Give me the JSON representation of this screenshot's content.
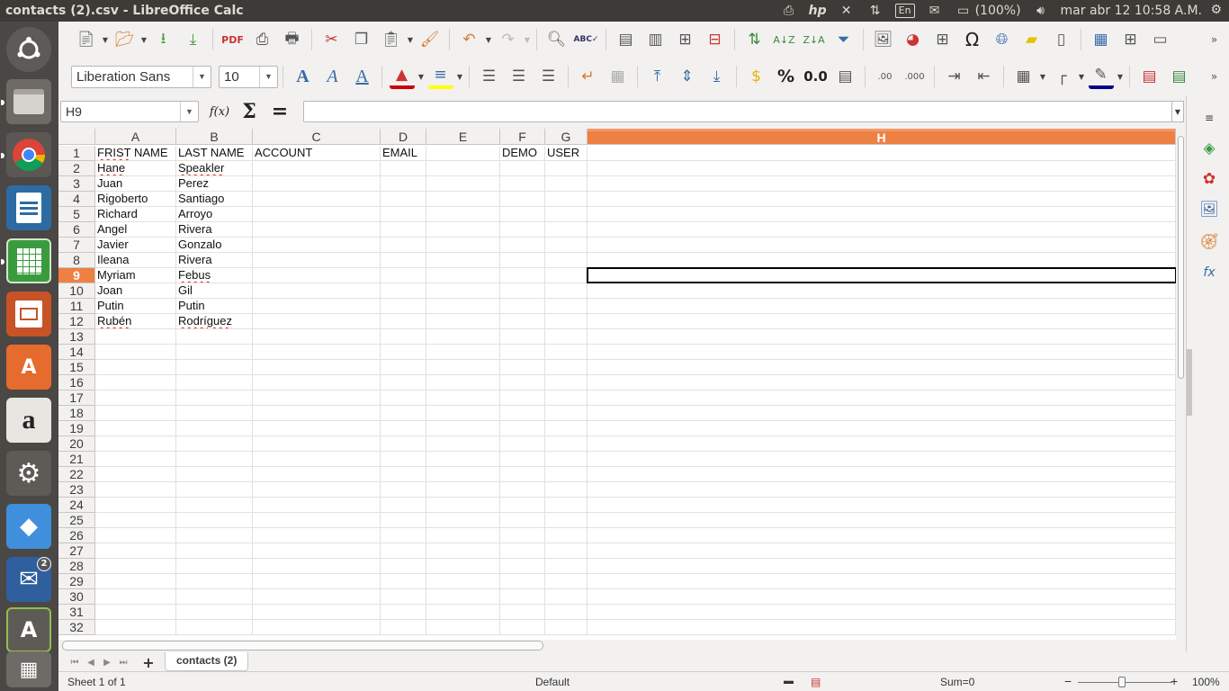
{
  "window": {
    "title": "contacts (2).csv - LibreOffice Calc"
  },
  "tray": {
    "keyboard_layout": "En",
    "battery": "(100%)",
    "clock": "mar abr 12 10:58 A.M."
  },
  "launcher": {
    "notification_badge": "2"
  },
  "toolbar": {
    "font_name": "Liberation Sans",
    "font_size": "10",
    "percent_label": "%",
    "number_label": "0.0",
    "omega_label": "Ω"
  },
  "formula_bar": {
    "cell_ref": "H9",
    "fx_label": "f(x)",
    "sum_label": "Σ",
    "equals_label": "=",
    "content": ""
  },
  "grid": {
    "columns": [
      "A",
      "B",
      "C",
      "D",
      "E",
      "F",
      "G",
      "H"
    ],
    "selected_column": "H",
    "selected_row": 9,
    "row_numbers": [
      1,
      2,
      3,
      4,
      5,
      6,
      7,
      8,
      9,
      10,
      11,
      12,
      13,
      14,
      15,
      16,
      17,
      18,
      19,
      20,
      21,
      22,
      23,
      24,
      25,
      26,
      27,
      28,
      29,
      30,
      31,
      32
    ],
    "header_row": [
      "FRIST NAME",
      "LAST NAME",
      "ACCOUNT",
      "EMAIL",
      "",
      "DEMO",
      "USER"
    ],
    "rows": [
      [
        "Hane",
        "Speakler"
      ],
      [
        "Juan",
        "Perez"
      ],
      [
        "Rigoberto",
        "Santiago"
      ],
      [
        "Richard",
        "Arroyo"
      ],
      [
        "Angel",
        "Rivera"
      ],
      [
        "Javier",
        "Gonzalo"
      ],
      [
        "Ileana",
        "Rivera"
      ],
      [
        "Myriam",
        "Febus"
      ],
      [
        "Joan",
        "Gil"
      ],
      [
        "Putin",
        "Putin"
      ],
      [
        "Rubén",
        "Rodríguez"
      ]
    ],
    "spellcheck_flagged": [
      "FRIST",
      "Hane",
      "Speakler",
      "Febus",
      "Rubén",
      "Rodríguez"
    ]
  },
  "sheet_tabs": {
    "add_label": "+",
    "tabs": [
      "contacts (2)"
    ]
  },
  "status_bar": {
    "sheet_info": "Sheet 1 of 1",
    "page_style": "Default",
    "sum": "Sum=0",
    "zoom_minus": "−",
    "zoom_plus": "+",
    "zoom": "100%"
  },
  "colors": {
    "selection_header": "#ee8044",
    "panel_bg": "#3c3b37",
    "launcher_bg": "#4a4745",
    "ui_bg": "#f2f1f0"
  }
}
